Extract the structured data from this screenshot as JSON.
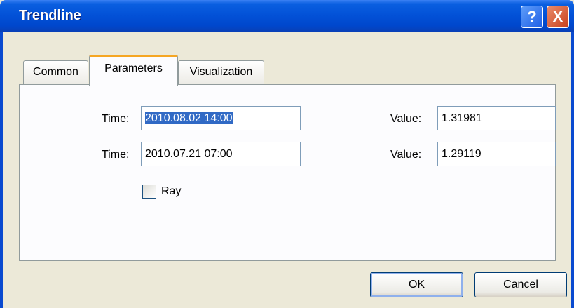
{
  "window": {
    "title": "Trendline",
    "help_label": "?",
    "close_label": "X"
  },
  "tabs": [
    {
      "label": "Common",
      "active": false
    },
    {
      "label": "Parameters",
      "active": true
    },
    {
      "label": "Visualization",
      "active": false
    }
  ],
  "parameters": {
    "time_label": "Time:",
    "value_label": "Value:",
    "rows": [
      {
        "time": "2010.08.02 14:00",
        "value": "1.31981"
      },
      {
        "time": "2010.07.21 07:00",
        "value": "1.29119"
      }
    ],
    "ray": {
      "label": "Ray",
      "checked": false
    }
  },
  "buttons": {
    "ok": "OK",
    "cancel": "Cancel"
  },
  "colors": {
    "titlebar": "#0352d8",
    "selection": "#316ac5",
    "active_tab_accent": "#f5a623"
  }
}
